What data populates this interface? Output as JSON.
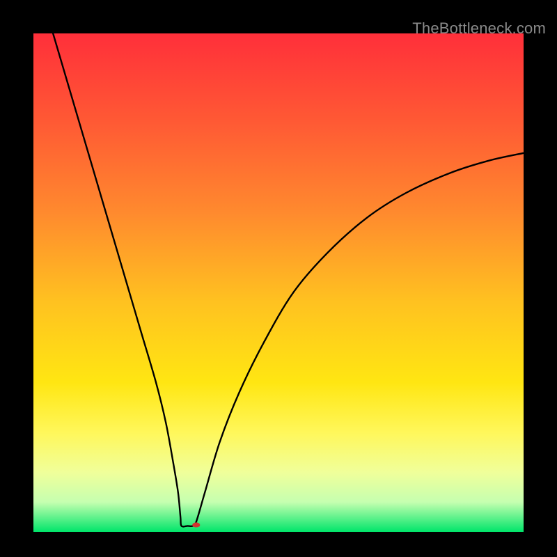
{
  "watermark": "TheBottleneck.com",
  "chart_data": {
    "type": "line",
    "title": "",
    "xlabel": "",
    "ylabel": "",
    "xlim": [
      0,
      100
    ],
    "ylim": [
      0,
      100
    ],
    "grid": false,
    "legend": false,
    "background_gradient": {
      "stops": [
        {
          "offset": 0,
          "color": "#ff2f3a"
        },
        {
          "offset": 18,
          "color": "#ff5a34"
        },
        {
          "offset": 36,
          "color": "#ff8a2e"
        },
        {
          "offset": 54,
          "color": "#ffc220"
        },
        {
          "offset": 70,
          "color": "#ffe612"
        },
        {
          "offset": 80,
          "color": "#fff75a"
        },
        {
          "offset": 88,
          "color": "#f0ff9a"
        },
        {
          "offset": 94,
          "color": "#c6ffb0"
        },
        {
          "offset": 100,
          "color": "#00e56a"
        }
      ]
    },
    "curve_points_xy": [
      [
        4,
        100
      ],
      [
        7,
        90
      ],
      [
        10,
        80
      ],
      [
        13,
        70
      ],
      [
        16,
        60
      ],
      [
        19,
        50
      ],
      [
        22,
        40
      ],
      [
        25,
        30
      ],
      [
        27,
        22
      ],
      [
        28.5,
        14
      ],
      [
        29.5,
        8
      ],
      [
        30,
        3
      ],
      [
        30.2,
        1.2
      ],
      [
        31.5,
        1.2
      ],
      [
        32.5,
        1.2
      ],
      [
        33.2,
        2
      ],
      [
        35,
        8
      ],
      [
        38,
        18
      ],
      [
        42,
        28
      ],
      [
        47,
        38
      ],
      [
        53,
        48
      ],
      [
        60,
        56
      ],
      [
        68,
        63
      ],
      [
        76,
        68
      ],
      [
        85,
        72
      ],
      [
        93,
        74.5
      ],
      [
        100,
        76
      ]
    ],
    "marker": {
      "x": 33.2,
      "y": 1.4,
      "rx": 0.8,
      "ry": 0.5,
      "color": "#d3332f"
    }
  }
}
